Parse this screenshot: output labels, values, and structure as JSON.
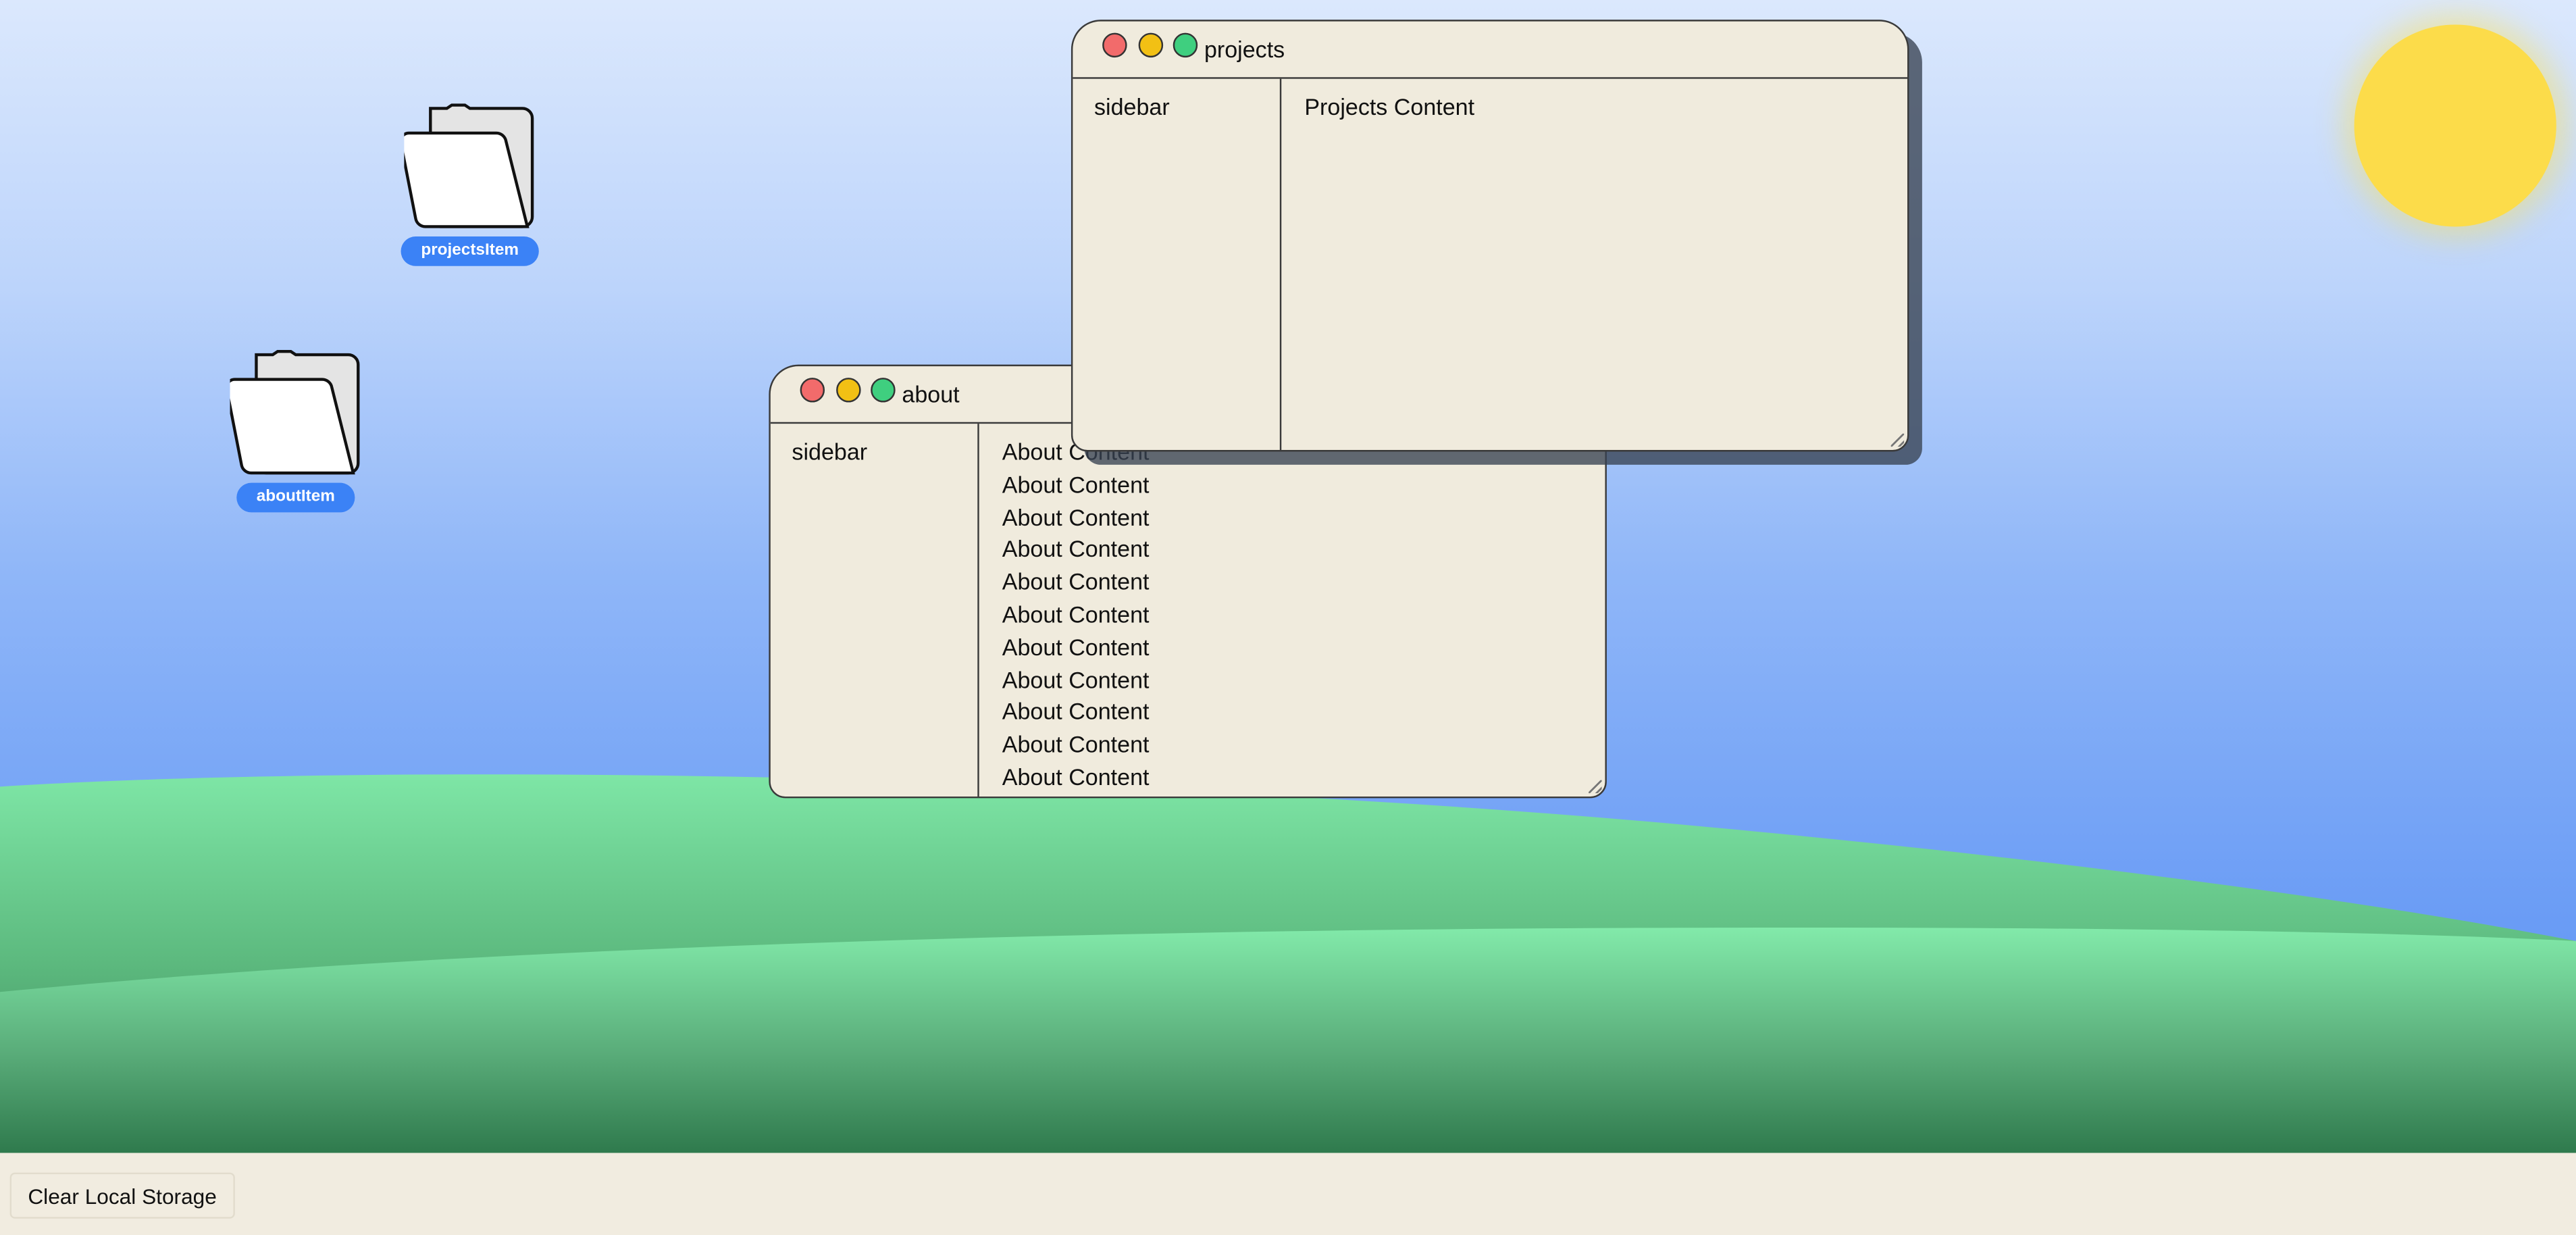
{
  "desktop": {
    "icons": [
      {
        "label": "projectsItem"
      },
      {
        "label": "aboutItem"
      }
    ]
  },
  "windows": {
    "about": {
      "title": "about",
      "sidebar": "sidebar",
      "lines": [
        "About Content",
        "About Content",
        "About Content",
        "About Content",
        "About Content",
        "About Content",
        "About Content",
        "About Content",
        "About Content",
        "About Content",
        "About Content"
      ]
    },
    "projects": {
      "title": "projects",
      "sidebar": "sidebar",
      "content": "Projects Content"
    }
  },
  "taskbar": {
    "clear_button_label": "Clear Local Storage"
  },
  "colors": {
    "sky_top": "#dbe8fd",
    "sky_bottom": "#5b91f2",
    "sun": "#fcdc4a",
    "hill_light": "#7ee6a6",
    "hill_dark": "#327d52",
    "window_bg": "#f0ebdd",
    "label_blue": "#3b82f6",
    "close": "#f26b6b",
    "minimize": "#f2c014",
    "maximize": "#3fcf7f"
  }
}
